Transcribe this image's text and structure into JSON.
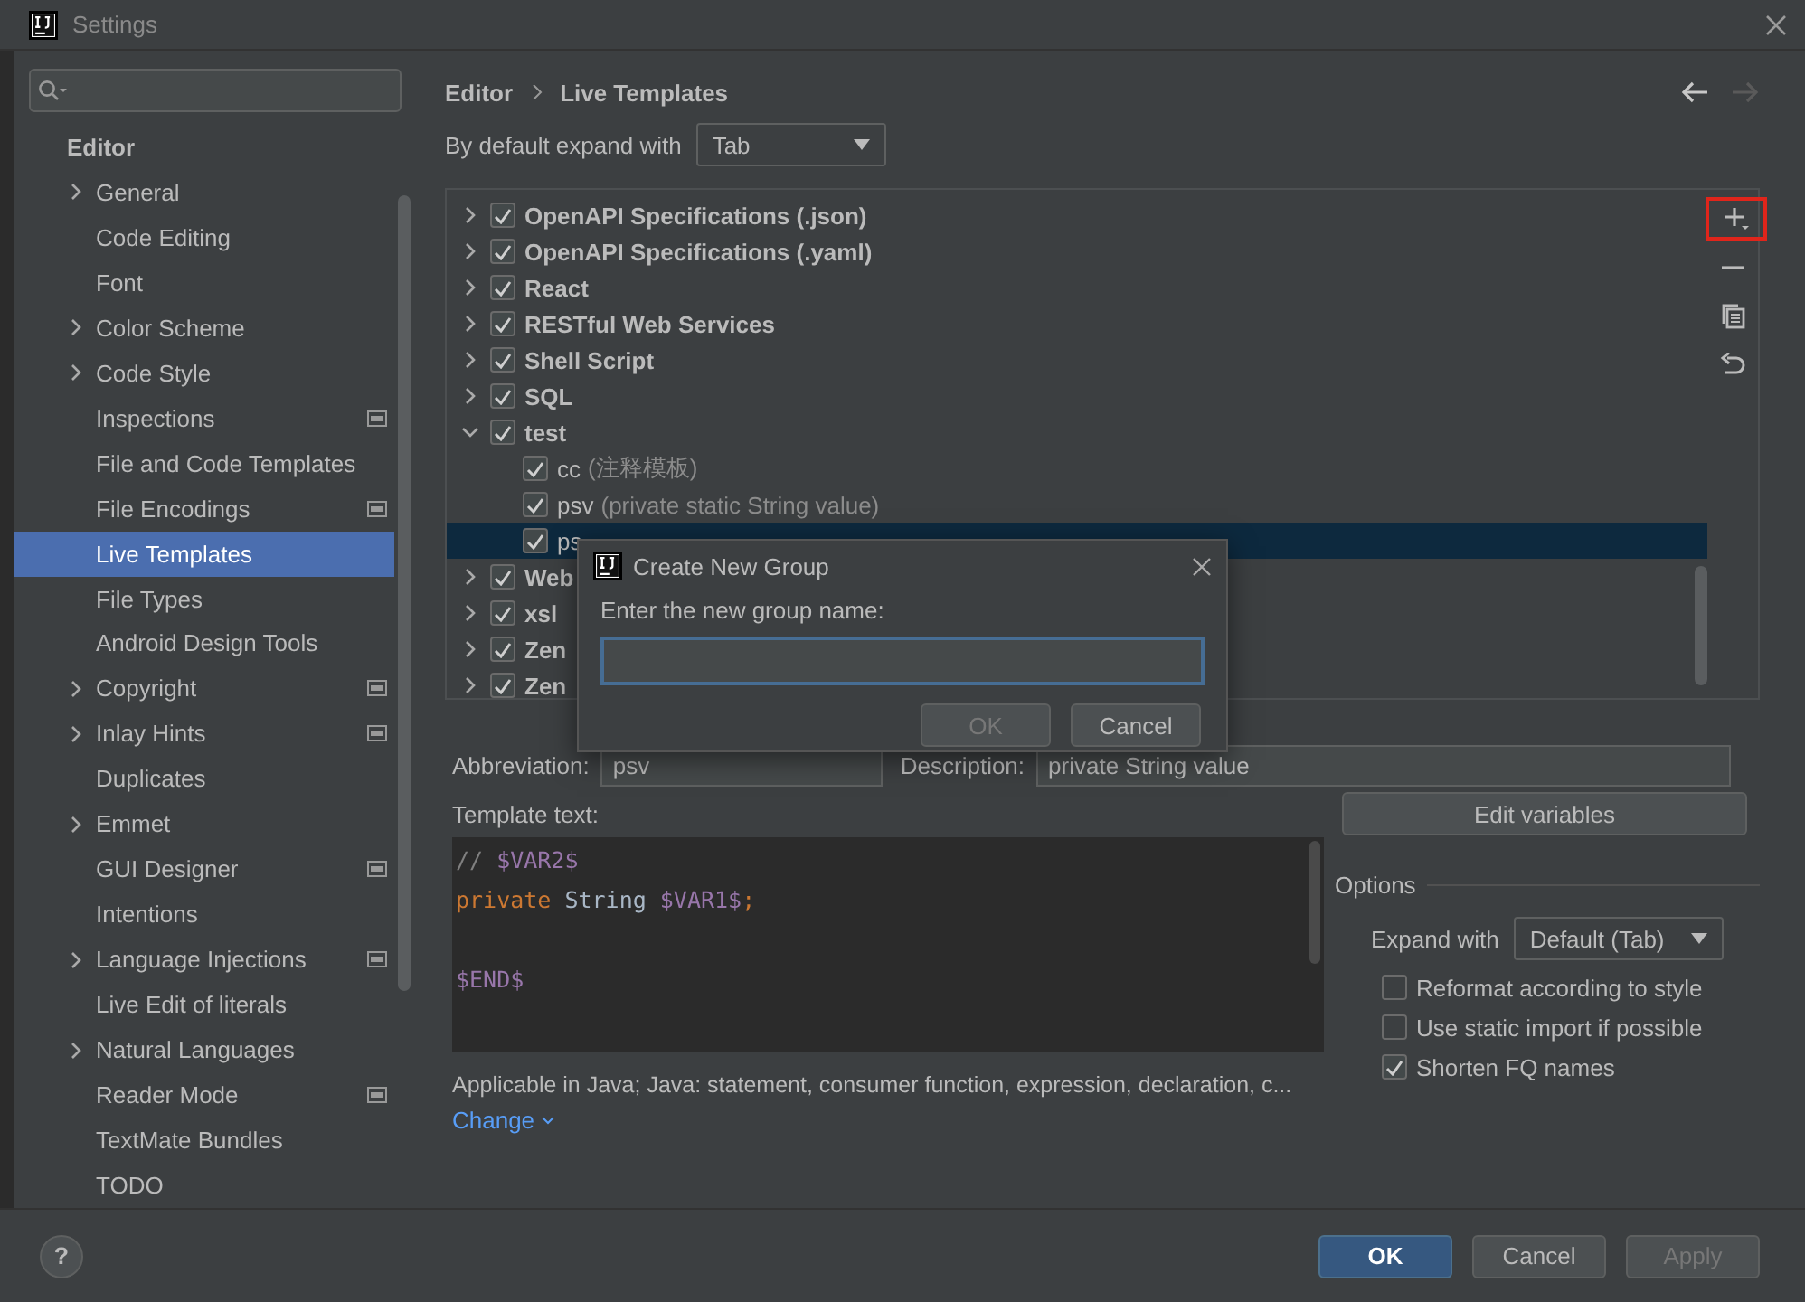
{
  "window": {
    "title": "Settings"
  },
  "sidebar": {
    "section": "Editor",
    "items": [
      {
        "label": "General",
        "expandable": true,
        "badge": false,
        "selected": false
      },
      {
        "label": "Code Editing",
        "expandable": false,
        "badge": false,
        "selected": false
      },
      {
        "label": "Font",
        "expandable": false,
        "badge": false,
        "selected": false
      },
      {
        "label": "Color Scheme",
        "expandable": true,
        "badge": false,
        "selected": false
      },
      {
        "label": "Code Style",
        "expandable": true,
        "badge": false,
        "selected": false
      },
      {
        "label": "Inspections",
        "expandable": false,
        "badge": true,
        "selected": false
      },
      {
        "label": "File and Code Templates",
        "expandable": false,
        "badge": false,
        "selected": false
      },
      {
        "label": "File Encodings",
        "expandable": false,
        "badge": true,
        "selected": false
      },
      {
        "label": "Live Templates",
        "expandable": false,
        "badge": false,
        "selected": true
      },
      {
        "label": "File Types",
        "expandable": false,
        "badge": false,
        "selected": false
      },
      {
        "label": "Android Design Tools",
        "expandable": false,
        "badge": false,
        "selected": false
      },
      {
        "label": "Copyright",
        "expandable": true,
        "badge": true,
        "selected": false
      },
      {
        "label": "Inlay Hints",
        "expandable": true,
        "badge": true,
        "selected": false
      },
      {
        "label": "Duplicates",
        "expandable": false,
        "badge": false,
        "selected": false
      },
      {
        "label": "Emmet",
        "expandable": true,
        "badge": false,
        "selected": false
      },
      {
        "label": "GUI Designer",
        "expandable": false,
        "badge": true,
        "selected": false
      },
      {
        "label": "Intentions",
        "expandable": false,
        "badge": false,
        "selected": false
      },
      {
        "label": "Language Injections",
        "expandable": true,
        "badge": true,
        "selected": false
      },
      {
        "label": "Live Edit of literals",
        "expandable": false,
        "badge": false,
        "selected": false
      },
      {
        "label": "Natural Languages",
        "expandable": true,
        "badge": false,
        "selected": false
      },
      {
        "label": "Reader Mode",
        "expandable": false,
        "badge": true,
        "selected": false
      },
      {
        "label": "TextMate Bundles",
        "expandable": false,
        "badge": false,
        "selected": false
      },
      {
        "label": "TODO",
        "expandable": false,
        "badge": false,
        "selected": false
      }
    ]
  },
  "breadcrumb": [
    "Editor",
    "Live Templates"
  ],
  "navigation": {
    "back_disabled": false,
    "forward_disabled": true
  },
  "expand_default": {
    "label": "By default expand with",
    "value": "Tab"
  },
  "template_groups": [
    {
      "label": "OpenAPI Specifications (.json)",
      "checked": true,
      "expanded": false
    },
    {
      "label": "OpenAPI Specifications (.yaml)",
      "checked": true,
      "expanded": false
    },
    {
      "label": "React",
      "checked": true,
      "expanded": false
    },
    {
      "label": "RESTful Web Services",
      "checked": true,
      "expanded": false
    },
    {
      "label": "Shell Script",
      "checked": true,
      "expanded": false
    },
    {
      "label": "SQL",
      "checked": true,
      "expanded": false
    },
    {
      "label": "test",
      "checked": true,
      "expanded": true,
      "children": [
        {
          "abbreviation": "cc",
          "description": "(注释模板)",
          "checked": true,
          "selected": false
        },
        {
          "abbreviation": "psv",
          "description": "(private static String value)",
          "checked": true,
          "selected": false
        },
        {
          "abbreviation": "ps",
          "checked": true,
          "selected": true
        }
      ]
    },
    {
      "label": "Web",
      "checked": true,
      "expanded": false
    },
    {
      "label": "xsl",
      "checked": true,
      "expanded": false
    },
    {
      "label": "Zen",
      "checked": true,
      "expanded": false
    },
    {
      "label": "Zen",
      "checked": true,
      "expanded": false
    }
  ],
  "toolbar": [
    {
      "kind": "add",
      "highlighted": true
    },
    {
      "kind": "remove",
      "highlighted": false
    },
    {
      "kind": "copy",
      "highlighted": false
    },
    {
      "kind": "restore",
      "highlighted": false
    }
  ],
  "dialog": {
    "title": "Create New Group",
    "prompt": "Enter the new group name:",
    "buttons": [
      {
        "label": "OK",
        "disabled": true
      },
      {
        "label": "Cancel",
        "disabled": false
      }
    ]
  },
  "abbreviation": {
    "label": "Abbreviation:",
    "value": "psv"
  },
  "description": {
    "label": "Description:",
    "value": "private String value"
  },
  "template_text": {
    "label": "Template text:",
    "lines": [
      {
        "gap_before": false,
        "segments": [
          {
            "text": "// ",
            "kind": "comment"
          },
          {
            "text": "$VAR2$",
            "kind": "variable"
          }
        ]
      },
      {
        "gap_before": false,
        "segments": [
          {
            "text": "private",
            "kind": "keyword"
          },
          {
            "text": " String ",
            "kind": "plain"
          },
          {
            "text": "$VAR1$",
            "kind": "variable"
          },
          {
            "text": ";",
            "kind": "keyword"
          }
        ]
      },
      {
        "gap_before": true,
        "segments": [
          {
            "text": "$END$",
            "kind": "variable"
          }
        ]
      }
    ]
  },
  "applicable": {
    "text": "Applicable in Java; Java: statement, consumer function, expression, declaration, c...",
    "link": "Change"
  },
  "edit_variables": "Edit variables",
  "options": {
    "title": "Options",
    "expand_with": {
      "label": "Expand with",
      "value": "Default (Tab)"
    },
    "checkboxes": [
      {
        "label": "Reformat according to style",
        "checked": false
      },
      {
        "label": "Use static import if possible",
        "checked": false
      },
      {
        "label": "Shorten FQ names",
        "checked": true
      }
    ]
  },
  "footer": {
    "help": "?",
    "buttons": [
      {
        "label": "OK",
        "kind": "primary",
        "disabled": false
      },
      {
        "label": "Cancel",
        "kind": "normal",
        "disabled": false
      },
      {
        "label": "Apply",
        "kind": "normal",
        "disabled": true
      }
    ]
  }
}
